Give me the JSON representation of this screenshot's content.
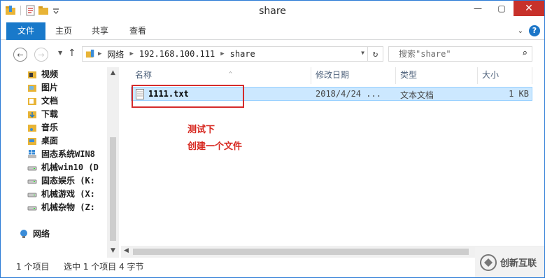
{
  "window": {
    "title": "share"
  },
  "ribbon": {
    "tabs": [
      "文件",
      "主页",
      "共享",
      "查看"
    ]
  },
  "address": {
    "crumbs": [
      "网络",
      "192.168.100.111",
      "share"
    ]
  },
  "search": {
    "placeholder": "搜索\"share\""
  },
  "sidebar": {
    "items": [
      {
        "label": "视频",
        "icon": "video-folder-icon"
      },
      {
        "label": "图片",
        "icon": "pictures-folder-icon"
      },
      {
        "label": "文档",
        "icon": "documents-folder-icon"
      },
      {
        "label": "下载",
        "icon": "downloads-folder-icon"
      },
      {
        "label": "音乐",
        "icon": "music-folder-icon"
      },
      {
        "label": "桌面",
        "icon": "desktop-folder-icon"
      },
      {
        "label": "固态系统WIN8",
        "icon": "windows-drive-icon"
      },
      {
        "label": "机械win10 (D",
        "icon": "drive-icon"
      },
      {
        "label": "固态娱乐 (K:",
        "icon": "drive-icon"
      },
      {
        "label": "机械游戏 (X:",
        "icon": "drive-icon"
      },
      {
        "label": "机械杂物 (Z:",
        "icon": "drive-icon"
      }
    ],
    "network": "网络"
  },
  "columns": {
    "name": "名称",
    "modified": "修改日期",
    "type": "类型",
    "size": "大小"
  },
  "files": [
    {
      "name": "1111.txt",
      "modified": "2018/4/24 ...",
      "type": "文本文档",
      "size": "1 KB"
    }
  ],
  "annotation": {
    "line1": "测试下",
    "line2": "创建一个文件"
  },
  "status": {
    "count": "1 个项目",
    "selected": "选中 1 个项目  4 字节"
  },
  "watermark": {
    "text": "创新互联"
  },
  "colors": {
    "accent": "#1979ca",
    "close": "#c7312b",
    "selection": "#cce8ff",
    "annotation": "#d7261e"
  }
}
